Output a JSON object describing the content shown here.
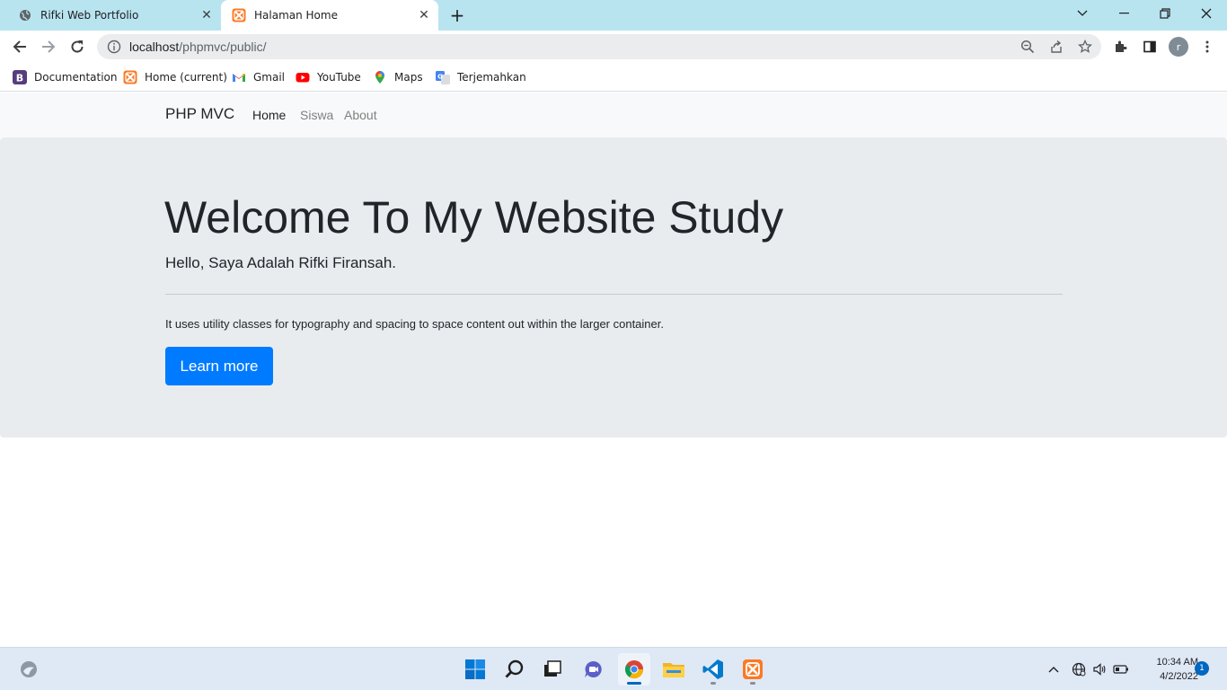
{
  "browser": {
    "tabs": [
      {
        "title": "Rifki Web Portfolio",
        "icon": "globe-icon",
        "active": false
      },
      {
        "title": "Halaman Home",
        "icon": "xampp-icon",
        "active": true
      }
    ],
    "new_tab_glyph": "+",
    "address": {
      "host": "localhost",
      "path": "/phpmvc/public/"
    },
    "profile_initial": "r",
    "bookmarks": [
      {
        "label": "Documentation",
        "icon": "bootstrap-icon"
      },
      {
        "label": "Home (current)",
        "icon": "xampp-icon"
      },
      {
        "label": "Gmail",
        "icon": "gmail-icon"
      },
      {
        "label": "YouTube",
        "icon": "youtube-icon"
      },
      {
        "label": "Maps",
        "icon": "maps-icon"
      },
      {
        "label": "Terjemahkan",
        "icon": "translate-icon"
      }
    ]
  },
  "page": {
    "navbar": {
      "brand": "PHP MVC",
      "links": [
        {
          "label": "Home",
          "active": true
        },
        {
          "label": "Siswa",
          "active": false
        },
        {
          "label": "About",
          "active": false
        }
      ]
    },
    "jumbotron": {
      "heading": "Welcome To My Website Study",
      "lead": "Hello, Saya Adalah Rifki Firansah.",
      "text": "It uses utility classes for typography and spacing to space content out within the larger container.",
      "button": "Learn more"
    }
  },
  "taskbar": {
    "apps": [
      "windows-start-icon",
      "search-icon",
      "task-view-icon",
      "chat-icon",
      "chrome-icon",
      "file-explorer-icon",
      "vscode-icon",
      "xampp-icon"
    ],
    "clock": {
      "time": "10:34 AM",
      "date": "4/2/2022"
    },
    "notification_count": "1"
  },
  "colors": {
    "tabstrip": "#b8e4f0",
    "jumbotron": "#e9ecef",
    "navbar": "#f8f9fa",
    "primary": "#007bff",
    "nav_inactive": "#808080"
  }
}
